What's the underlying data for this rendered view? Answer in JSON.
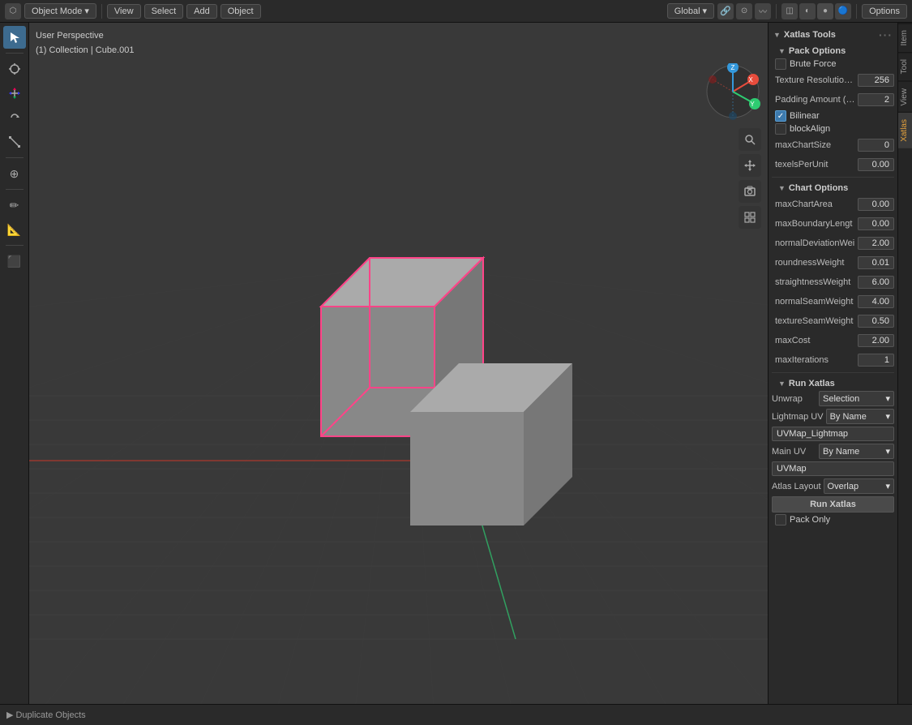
{
  "topbar": {
    "editor_icon": "⬡",
    "object_mode_label": "Object Mode",
    "view_label": "View",
    "select_label": "Select",
    "add_label": "Add",
    "object_label": "Object",
    "global_label": "Global",
    "snap_icon": "🧲",
    "options_label": "Options",
    "viewport_icons": [
      "🌐",
      "⬡",
      "◉",
      "🔵",
      "●"
    ]
  },
  "viewport": {
    "perspective_label": "User Perspective",
    "collection_label": "(1) Collection | Cube.001"
  },
  "left_toolbar": {
    "tools": [
      "⇔",
      "↔",
      "↕",
      "⟳",
      "⊕",
      "⊙",
      "✏",
      "📐",
      "⬛"
    ]
  },
  "panel_tabs": [
    "Tool",
    "View",
    "Xatlas"
  ],
  "xatlas": {
    "title": "Xatlas Tools",
    "pack_options": {
      "title": "Pack Options",
      "brute_force": {
        "label": "Brute Force",
        "checked": false
      },
      "texture_resolution": {
        "label": "Texture Resolution (p",
        "value": "256"
      },
      "padding_amount": {
        "label": "Padding Amount (px)",
        "value": "2"
      },
      "bilinear": {
        "label": "Bilinear",
        "checked": true
      },
      "block_align": {
        "label": "blockAlign",
        "checked": false
      },
      "max_chart_size": {
        "label": "maxChartSize",
        "value": "0"
      },
      "texels_per_unit": {
        "label": "texelsPerUnit",
        "value": "0.00"
      }
    },
    "chart_options": {
      "title": "Chart Options",
      "rows": [
        {
          "label": "maxChartArea",
          "value": "0.00"
        },
        {
          "label": "maxBoundaryLengt",
          "value": "0.00"
        },
        {
          "label": "normalDeviationWei",
          "value": "2.00"
        },
        {
          "label": "roundnessWeight",
          "value": "0.01"
        },
        {
          "label": "straightnessWeight",
          "value": "6.00"
        },
        {
          "label": "normalSeamWeight",
          "value": "4.00"
        },
        {
          "label": "textureSeamWeight",
          "value": "0.50"
        },
        {
          "label": "maxCost",
          "value": "2.00"
        },
        {
          "label": "maxIterations",
          "value": "1"
        }
      ]
    },
    "run_xatlas": {
      "title": "Run Xatlas",
      "unwrap_label": "Unwrap",
      "unwrap_value": "Selection",
      "lightmap_uv_label": "Lightmap UV",
      "lightmap_uv_value": "By Name",
      "lightmap_uv_name": "UVMap_Lightmap",
      "main_uv_label": "Main UV",
      "main_uv_value": "By Name",
      "main_uv_name": "UVMap",
      "atlas_layout_label": "Atlas Layout",
      "atlas_layout_value": "Overlap",
      "run_button": "Run Xatlas",
      "pack_only_label": "Pack Only",
      "pack_only_checked": false
    }
  },
  "bottom_bar": {
    "duplicate_label": "Duplicate Objects"
  }
}
